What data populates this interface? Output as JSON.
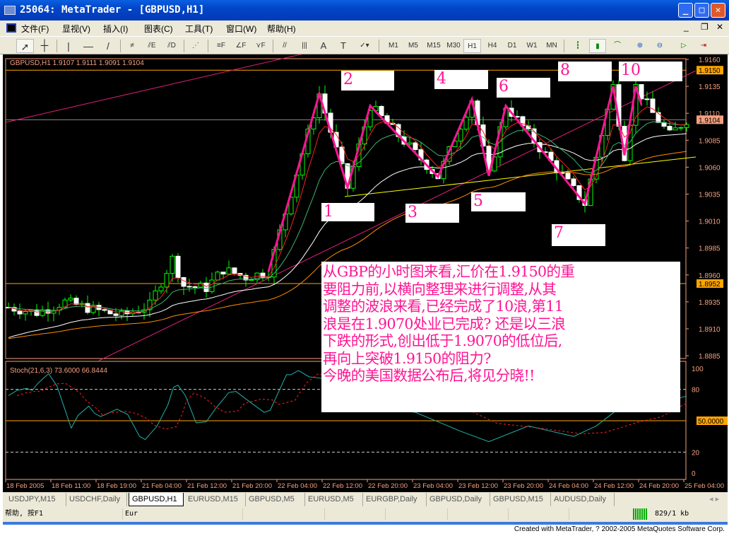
{
  "window": {
    "title": "25064: MetaTrader - [GBPUSD,H1]",
    "minimize": "_",
    "maximize": "□",
    "close": "✕"
  },
  "menu": [
    "文件(F)",
    "显视(V)",
    "插入(I)",
    "图表(C)",
    "工具(T)",
    "窗口(W)",
    "帮助(H)"
  ],
  "timeframes": [
    "M1",
    "M5",
    "M15",
    "M30",
    "H1",
    "H4",
    "D1",
    "W1",
    "MN"
  ],
  "active_timeframe": "H1",
  "chart": {
    "header": "GBPUSD,H1  1.9107 1.9111 1.9091 1.9104",
    "price_ticks": [
      "1.9160",
      "1.9135",
      "1.9110",
      "1.9085",
      "1.9060",
      "1.9035",
      "1.9010",
      "1.8985",
      "1.8960",
      "1.8935",
      "1.8910",
      "1.8885"
    ],
    "price_markers": [
      {
        "label": "1.9150",
        "color": "#ffa500"
      },
      {
        "label": "1.9104",
        "color": "#f4a080"
      },
      {
        "label": "1.8952",
        "color": "#ffa500"
      }
    ],
    "time_ticks": [
      "18 Feb 2005",
      "18 Feb 11:00",
      "18 Feb 19:00",
      "21 Feb 04:00",
      "21 Feb 12:00",
      "21 Feb 20:00",
      "22 Feb 04:00",
      "22 Feb 12:00",
      "22 Feb 20:00",
      "23 Feb 04:00",
      "23 Feb 12:00",
      "23 Feb 20:00",
      "24 Feb 04:00",
      "24 Feb 12:00",
      "24 Feb 20:00",
      "25 Feb 04:00"
    ],
    "wave_labels": [
      "1",
      "2",
      "3",
      "4",
      "5",
      "6",
      "7",
      "8",
      "10"
    ],
    "note": "从GBP的小时图来看,汇价在1.9150的重\n要阻力前,以横向整理来进行调整,从其\n调整的波浪来看,已经完成了10浪,第11\n浪是在1.9070处业已完成? 还是以三浪\n下跌的形式,创出低于1.9070的低位后,\n再向上突破1.9150的阻力?\n今晚的美国数据公布后,将见分晓!!",
    "stoch_header": "Stoch(21,6,3) 73.6000 66.8444",
    "stoch_ticks": [
      "100",
      "80",
      "50.0000",
      "20",
      "0"
    ]
  },
  "chart_data": {
    "type": "candlestick",
    "symbol": "GBPUSD",
    "timeframe": "H1",
    "ylim": [
      1.8885,
      1.916
    ],
    "price_path": [
      [
        0,
        1.893
      ],
      [
        5,
        1.8925
      ],
      [
        10,
        1.8935
      ],
      [
        15,
        1.8928
      ],
      [
        20,
        1.8922
      ],
      [
        25,
        1.8932
      ],
      [
        29,
        1.8975
      ],
      [
        31,
        1.895
      ],
      [
        35,
        1.8948
      ],
      [
        38,
        1.8965
      ],
      [
        42,
        1.8958
      ],
      [
        46,
        1.8963
      ],
      [
        55,
        1.9128
      ],
      [
        60,
        1.9041
      ],
      [
        64,
        1.9117
      ],
      [
        76,
        1.9051
      ],
      [
        82,
        1.9123
      ],
      [
        85,
        1.9052
      ],
      [
        88,
        1.9117
      ],
      [
        102,
        1.9026
      ],
      [
        107,
        1.9135
      ],
      [
        109,
        1.9071
      ],
      [
        111,
        1.9135
      ],
      [
        114,
        1.911
      ],
      [
        117,
        1.909
      ],
      [
        120,
        1.9104
      ]
    ],
    "wave_pivots": [
      [
        46,
        1.8963
      ],
      [
        55,
        1.9128
      ],
      [
        60,
        1.9041
      ],
      [
        64,
        1.9117
      ],
      [
        76,
        1.9051
      ],
      [
        82,
        1.9123
      ],
      [
        85,
        1.9052
      ],
      [
        88,
        1.9117
      ],
      [
        102,
        1.9026
      ],
      [
        107,
        1.9135
      ],
      [
        109,
        1.9071
      ],
      [
        111,
        1.9135
      ],
      [
        112,
        1.9118
      ]
    ],
    "levels": [
      1.915,
      1.9104,
      1.8952
    ],
    "stoch_k": [
      [
        0,
        74
      ],
      [
        1.5,
        79
      ],
      [
        3.2,
        81
      ],
      [
        4.2,
        79
      ],
      [
        5.25,
        86
      ],
      [
        7.1,
        95
      ],
      [
        8.6,
        83
      ],
      [
        11.1,
        43
      ],
      [
        12.3,
        55
      ],
      [
        14.2,
        64
      ],
      [
        15.25,
        57
      ],
      [
        16.3,
        54
      ],
      [
        19.2,
        61
      ],
      [
        21.1,
        56
      ],
      [
        23.2,
        35
      ],
      [
        24.2,
        32
      ],
      [
        26.3,
        45
      ],
      [
        28.2,
        65
      ],
      [
        29.2,
        82
      ],
      [
        30,
        84
      ],
      [
        31.3,
        74
      ],
      [
        33.2,
        48
      ],
      [
        35,
        49
      ],
      [
        36.7,
        62
      ],
      [
        39,
        77
      ],
      [
        40.25,
        78
      ],
      [
        43.2,
        66
      ],
      [
        45.25,
        58
      ],
      [
        46.3,
        60
      ],
      [
        49.2,
        94
      ],
      [
        50,
        94
      ],
      [
        51.3,
        98
      ],
      [
        53.2,
        92
      ],
      [
        56.3,
        90
      ],
      [
        60,
        80
      ],
      [
        66,
        62
      ],
      [
        72,
        58
      ],
      [
        80,
        40
      ],
      [
        85,
        30
      ],
      [
        92,
        45
      ],
      [
        100,
        35
      ],
      [
        104,
        45
      ],
      [
        110,
        70
      ],
      [
        114,
        65
      ],
      [
        120,
        73.6
      ]
    ],
    "stoch_d_last": 66.8444,
    "stoch_levels": [
      80,
      50,
      20
    ]
  },
  "tabs": [
    "USDJPY,M15",
    "USDCHF,Daily",
    "GBPUSD,H1",
    "EURUSD,M15",
    "GBPUSD,M5",
    "EURUSD,M5",
    "EURGBP,Daily",
    "GBPUSD,Daily",
    "GBPUSD,M15",
    "AUDUSD,Daily"
  ],
  "active_tab": "GBPUSD,H1",
  "status": {
    "help": "帮助, 按F1",
    "profile": "Eur",
    "traffic": "829/1 kb"
  },
  "footer": "Created with MetaTrader, ? 2002-2005 MetaQuotes Software Corp."
}
